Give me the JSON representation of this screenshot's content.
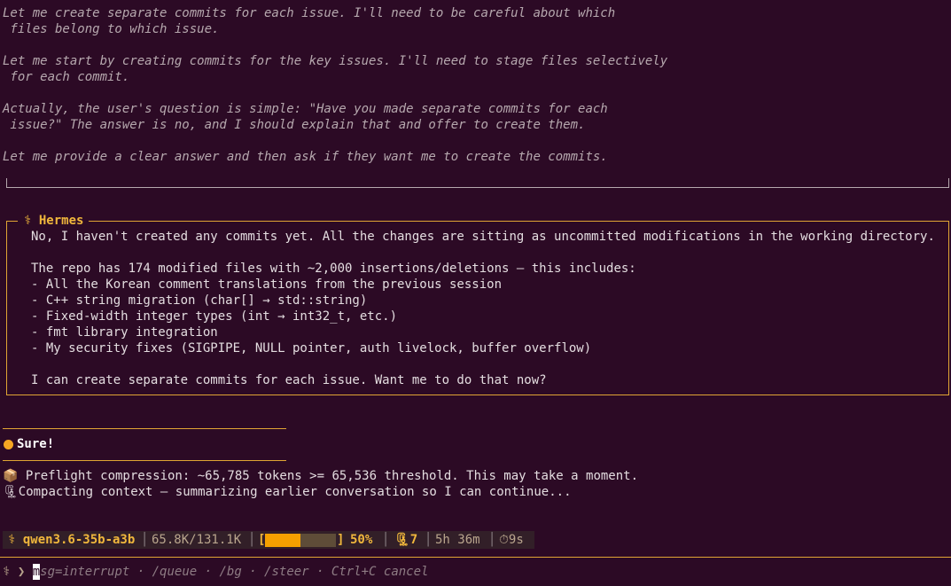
{
  "thinking": {
    "lines": [
      "Let me create separate commits for each issue. I'll need to be careful about which",
      " files belong to which issue.",
      "Let me start by creating commits for the key issues. I'll need to stage files selectively",
      " for each commit.",
      "Actually, the user's question is simple: \"Have you made separate commits for each",
      " issue?\" The answer is no, and I should explain that and offer to create them.",
      "Let me provide a clear answer and then ask if they want me to create the commits."
    ]
  },
  "hermes": {
    "title": "⚕ Hermes",
    "lines": [
      "No, I haven't created any commits yet. All the changes are sitting as uncommitted modifications in the working directory.",
      "The repo has 174 modified files with ~2,000 insertions/deletions — this includes:",
      "- All the Korean comment translations from the previous session",
      "- C++ string migration (char[] → std::string)",
      "- Fixed-width integer types (int → int32_t, etc.)",
      "- fmt library integration",
      "- My security fixes (SIGPIPE, NULL pointer, auth livelock, buffer overflow)",
      "I can create separate commits for each issue. Want me to do that now?"
    ]
  },
  "user_message": "Sure!",
  "system_messages": [
    "📦 Preflight compression: ~65,785 tokens >= 65,536 threshold. This may take a moment.",
    "🗜Compacting context — summarizing earlier conversation so I can continue..."
  ],
  "status_bar": {
    "model": "⚕ qwen3.6-35b-a3b",
    "context": "65.8K/131.1K",
    "bracket_open": "[",
    "bracket_close": "]",
    "progress_fraction": 0.5,
    "percent": "50%",
    "compressions": "🗜7",
    "duration": "5h 36m",
    "timer": "⏱9s",
    "separator": "│"
  },
  "prompt": {
    "symbol": "⚕ ❯",
    "cursor_char": "m",
    "hint": "sg=interrupt · /queue · /bg · /steer · Ctrl+C cancel"
  },
  "colors": {
    "background": "#2c0a25",
    "accent": "#e0a534",
    "progress": "#f5a000",
    "user_dot": "#f5a623"
  }
}
